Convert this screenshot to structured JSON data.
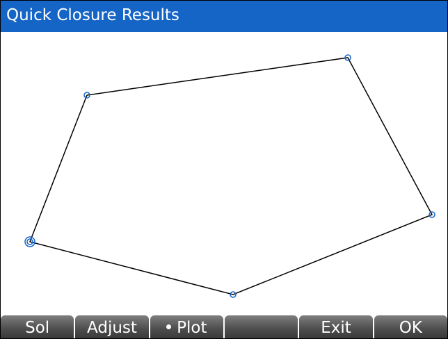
{
  "title": "Quick Closure Results",
  "colors": {
    "titlebar": "#1565c7",
    "plot_line": "#000000",
    "point_marker": "#1565c7",
    "softkey_bg": "#4d4d4d",
    "softkey_text": "#ffffff"
  },
  "softkeys": [
    {
      "label": "Sol",
      "active": false
    },
    {
      "label": "Adjust",
      "active": false
    },
    {
      "label": "Plot",
      "active": true
    },
    {
      "label": "",
      "active": false
    },
    {
      "label": "Exit",
      "active": false
    },
    {
      "label": "OK",
      "active": false
    }
  ]
}
